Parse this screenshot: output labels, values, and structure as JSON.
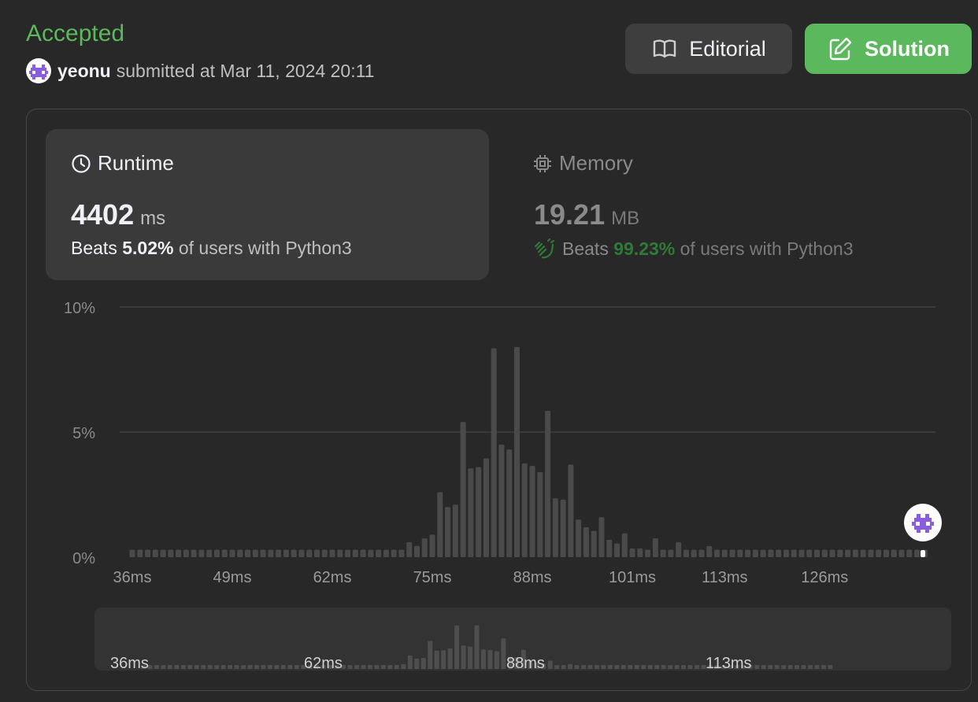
{
  "submission": {
    "status": "Accepted",
    "username": "yeonu",
    "submitted_text": "submitted at Mar 11, 2024 20:11"
  },
  "buttons": {
    "editorial": "Editorial",
    "solution": "Solution"
  },
  "runtime": {
    "title": "Runtime",
    "value": "4402",
    "unit": "ms",
    "beats_label": "Beats",
    "beats_pct": "5.02%",
    "beats_rest": "of users with Python3"
  },
  "memory": {
    "title": "Memory",
    "value": "19.21",
    "unit": "MB",
    "beats_label": "Beats",
    "beats_pct": "99.23%",
    "beats_rest": "of users with Python3"
  },
  "colors": {
    "accent_green": "#5cb85c",
    "memory_green": "#2f7a36",
    "bar": "#4a4a4a",
    "avatar_purple": "#8a5ce0"
  },
  "icons": {
    "editorial": "book-open-icon",
    "solution": "edit-icon",
    "runtime": "clock-icon",
    "memory": "cpu-chip-icon",
    "beats": "clapping-hands-icon",
    "avatar": "pixel-invader-avatar"
  },
  "chart_data": {
    "type": "bar",
    "ylabel": "",
    "xlabel": "",
    "y_ticks": [
      "10%",
      "5%",
      "0%"
    ],
    "ylim": [
      0,
      10
    ],
    "x_tick_labels": [
      "36ms",
      "49ms",
      "62ms",
      "75ms",
      "88ms",
      "101ms",
      "113ms",
      "126ms"
    ],
    "x_tick_positions": [
      36,
      49,
      62,
      75,
      88,
      101,
      113,
      126
    ],
    "x": [
      36,
      37,
      38,
      39,
      40,
      41,
      42,
      43,
      44,
      45,
      46,
      47,
      48,
      49,
      50,
      51,
      52,
      53,
      54,
      55,
      56,
      57,
      58,
      59,
      60,
      61,
      62,
      63,
      64,
      65,
      66,
      67,
      68,
      69,
      70,
      71,
      72,
      73,
      74,
      75,
      76,
      77,
      78,
      79,
      80,
      81,
      82,
      83,
      84,
      85,
      86,
      87,
      88,
      89,
      90,
      91,
      92,
      93,
      94,
      95,
      96,
      97,
      98,
      99,
      100,
      101,
      102,
      103,
      104,
      105,
      106,
      107,
      108,
      109,
      110,
      111,
      112,
      113,
      114,
      115,
      116,
      117,
      118,
      119,
      120,
      121,
      122,
      123,
      124,
      125,
      126,
      127,
      128,
      129,
      130,
      131,
      132,
      133,
      134,
      135,
      136,
      137,
      138,
      139
    ],
    "values": [
      0.3,
      0.3,
      0.3,
      0.3,
      0.3,
      0.3,
      0.3,
      0.3,
      0.3,
      0.3,
      0.3,
      0.3,
      0.3,
      0.3,
      0.3,
      0.3,
      0.3,
      0.3,
      0.3,
      0.3,
      0.3,
      0.3,
      0.3,
      0.3,
      0.3,
      0.3,
      0.3,
      0.3,
      0.3,
      0.3,
      0.3,
      0.3,
      0.3,
      0.3,
      0.3,
      0.3,
      0.6,
      0.45,
      0.75,
      0.9,
      2.6,
      2.0,
      2.1,
      5.4,
      3.55,
      3.6,
      3.95,
      8.35,
      4.5,
      4.3,
      8.4,
      3.75,
      3.65,
      3.4,
      5.85,
      2.35,
      2.3,
      3.7,
      1.5,
      1.2,
      1.05,
      1.6,
      0.7,
      0.55,
      0.95,
      0.35,
      0.35,
      0.3,
      0.75,
      0.3,
      0.3,
      0.6,
      0.3,
      0.3,
      0.3,
      0.45,
      0.3,
      0.3,
      0.3,
      0.3,
      0.3,
      0.3,
      0.3,
      0.3,
      0.3,
      0.3,
      0.3,
      0.3,
      0.3,
      0.3,
      0.3,
      0.3,
      0.3,
      0.3,
      0.3,
      0.3,
      0.3,
      0.3,
      0.3,
      0.3,
      0.3,
      0.3,
      0.3,
      0.3
    ],
    "current_runtime_marker": "4402 ms (beyond range, shown at right edge)",
    "overview": {
      "x_tick_labels": [
        "36ms",
        "62ms",
        "88ms",
        "113ms"
      ],
      "x_tick_positions": [
        36,
        62,
        88,
        113
      ]
    },
    "grid": true
  }
}
